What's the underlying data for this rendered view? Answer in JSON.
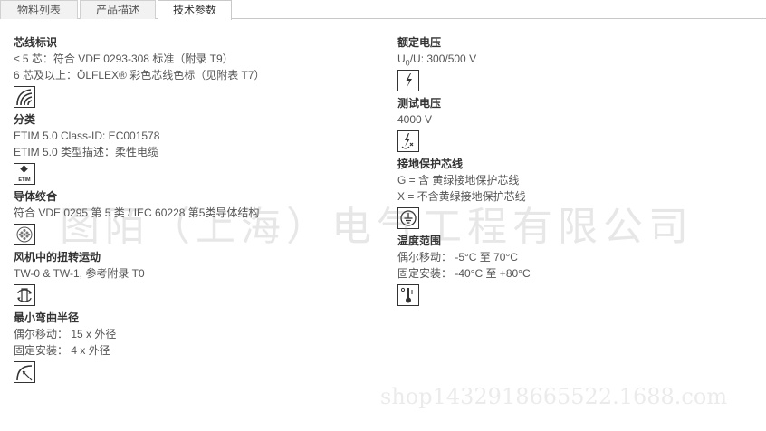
{
  "tabs": [
    {
      "label": "物料列表"
    },
    {
      "label": "产品描述"
    },
    {
      "label": "技术参数"
    }
  ],
  "left": {
    "core_id": {
      "title": "芯线标识",
      "lines": [
        "≤ 5 芯：符合 VDE 0293-308 标准（附录 T9）",
        "6 芯及以上：ÖLFLEX® 彩色芯线色标（见附表 T7）"
      ],
      "icon": "core-marking-icon"
    },
    "classification": {
      "title": "分类",
      "lines": [
        "ETIM 5.0 Class-ID: EC001578",
        "ETIM 5.0 类型描述：柔性电缆"
      ],
      "icon": "etim-icon",
      "icon_text": "ETIM"
    },
    "conductor": {
      "title": "导体绞合",
      "lines": [
        "符合 VDE 0295 第 5 类 / IEC 60228 第5类导体结构"
      ],
      "icon": "conductor-strand-icon"
    },
    "torsion": {
      "title": "风机中的扭转运动",
      "lines": [
        "TW-0 & TW-1, 参考附录 T0"
      ],
      "icon": "torsion-icon"
    },
    "bending": {
      "title": "最小弯曲半径",
      "lines": [
        "偶尔移动： 15 x 外径",
        "固定安装： 4 x 外径"
      ],
      "icon": "bending-radius-icon"
    }
  },
  "right": {
    "rated_voltage": {
      "title": "额定电压",
      "u0": "0",
      "value": "/U: 300/500 V",
      "prefix": "U",
      "icon": "rated-voltage-icon"
    },
    "test_voltage": {
      "title": "测试电压",
      "lines": [
        "4000 V"
      ],
      "icon": "test-voltage-icon"
    },
    "earth": {
      "title": "接地保护芯线",
      "lines": [
        "G = 含 黄绿接地保护芯线",
        "X = 不含黄绿接地保护芯线"
      ],
      "icon": "ground-icon"
    },
    "temperature": {
      "title": "温度范围",
      "lines": [
        "偶尔移动： -5°C 至 70°C",
        "固定安装： -40°C 至 +80°C"
      ],
      "icon": "thermometer-icon"
    }
  },
  "watermark": {
    "main": "图陌（上海）电气工程有限公司",
    "shop": "shop1432918665522.1688.com"
  }
}
